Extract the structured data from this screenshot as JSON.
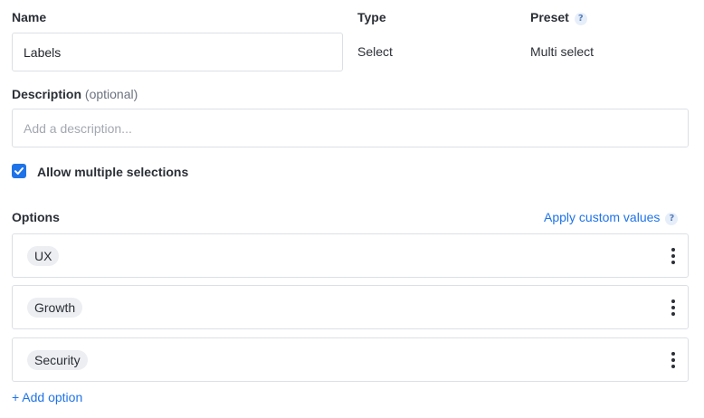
{
  "name_field": {
    "label": "Name",
    "value": "Labels"
  },
  "type_field": {
    "label": "Type",
    "value": "Select"
  },
  "preset_field": {
    "label": "Preset",
    "help_icon": "?",
    "value": "Multi select"
  },
  "description_field": {
    "label": "Description",
    "optional_label": "(optional)",
    "placeholder": "Add a description...",
    "value": ""
  },
  "allow_multiple": {
    "label": "Allow multiple selections",
    "checked": true
  },
  "options_section": {
    "label": "Options",
    "apply_custom_values_label": "Apply custom values",
    "help_icon": "?",
    "items": [
      {
        "label": "UX"
      },
      {
        "label": "Growth"
      },
      {
        "label": "Security"
      }
    ],
    "add_option_label": "+ Add option"
  },
  "colors": {
    "accent": "#1f73e8",
    "border": "#dcdfe4",
    "chip_background": "#eceef1"
  }
}
